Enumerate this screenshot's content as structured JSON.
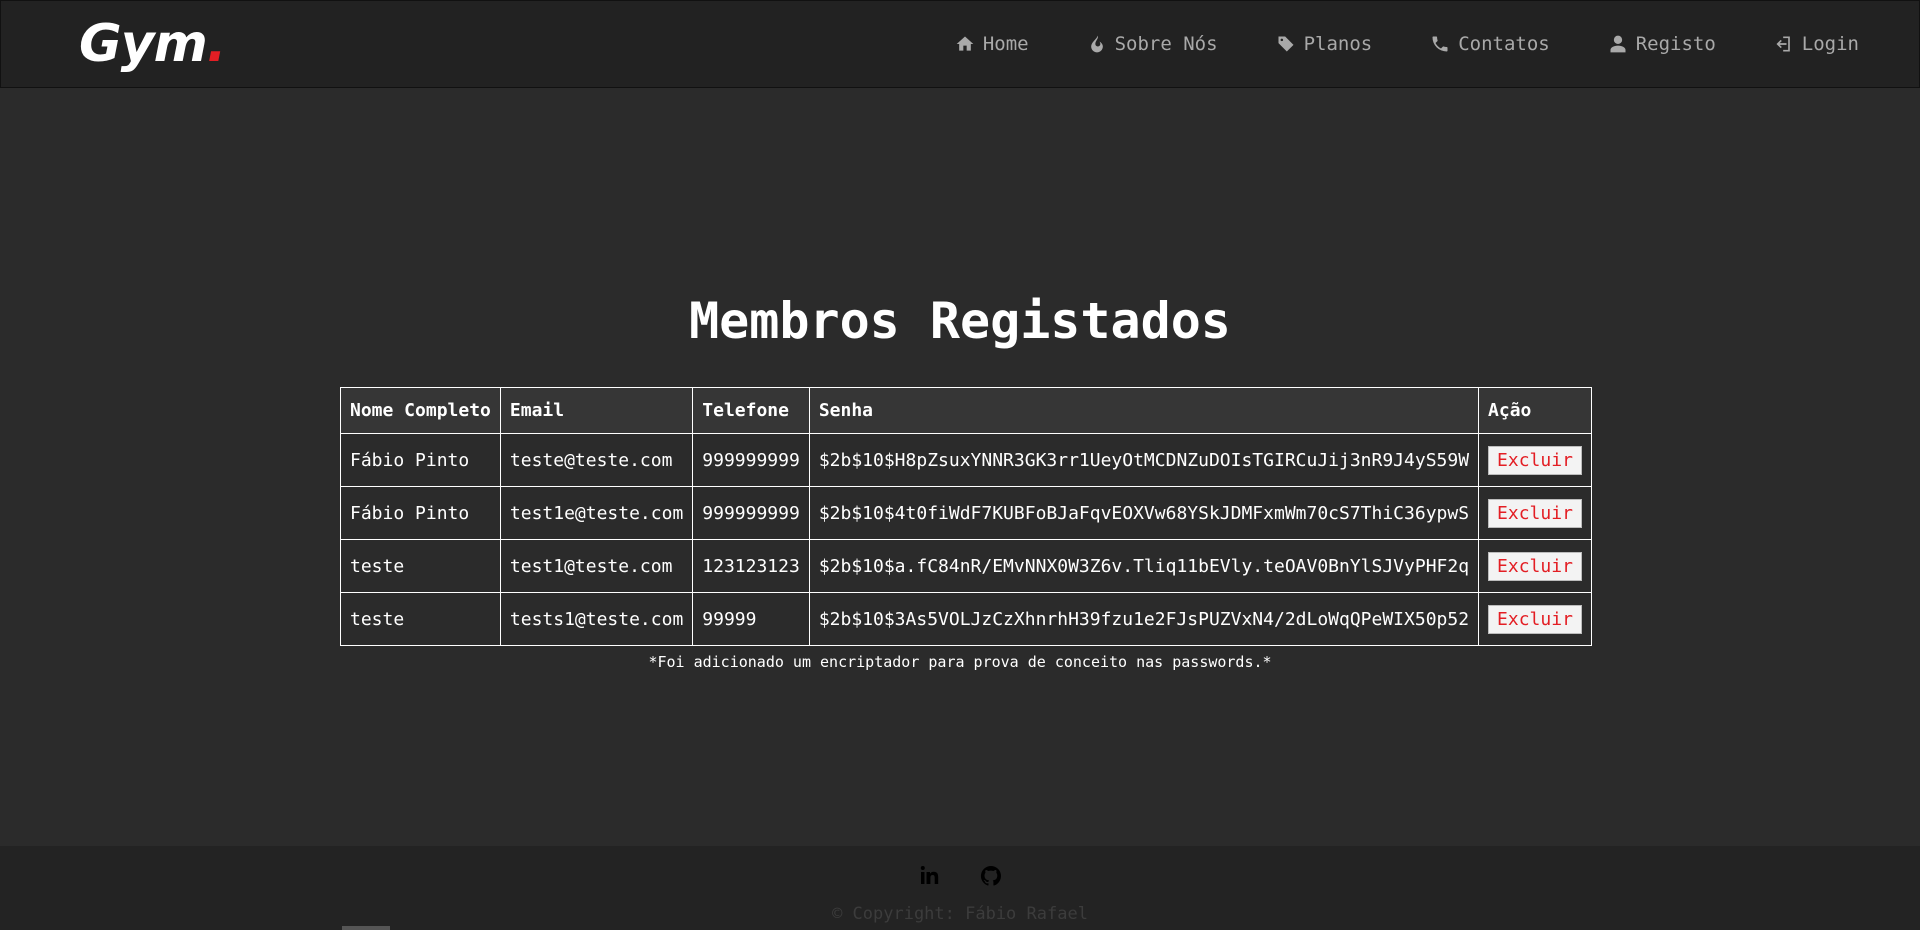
{
  "brand": {
    "name": "Gym",
    "dot": "."
  },
  "nav": {
    "items": [
      {
        "label": "Home",
        "icon": "home-icon"
      },
      {
        "label": "Sobre Nós",
        "icon": "fire-icon"
      },
      {
        "label": "Planos",
        "icon": "tag-icon"
      },
      {
        "label": "Contatos",
        "icon": "phone-icon"
      },
      {
        "label": "Registo",
        "icon": "user-icon"
      },
      {
        "label": "Login",
        "icon": "login-icon"
      }
    ]
  },
  "main": {
    "title": "Membros Registados",
    "table": {
      "headers": [
        "Nome Completo",
        "Email",
        "Telefone",
        "Senha",
        "Ação"
      ],
      "rows": [
        {
          "name": "Fábio Pinto",
          "email": "teste@teste.com",
          "phone": "999999999",
          "password": "$2b$10$H8pZsuxYNNR3GK3rr1UeyOtMCDNZuDOIsTGIRCuJij3nR9J4yS59W",
          "action": "Excluir"
        },
        {
          "name": "Fábio Pinto",
          "email": "test1e@teste.com",
          "phone": "999999999",
          "password": "$2b$10$4t0fiWdF7KUBFoBJaFqvEOXVw68YSkJDMFxmWm70cS7ThiC36ypwS",
          "action": "Excluir"
        },
        {
          "name": "teste",
          "email": "test1@teste.com",
          "phone": "123123123",
          "password": "$2b$10$a.fC84nR/EMvNNX0W3Z6v.Tliq11bEVly.teOAV0BnYlSJVyPHF2q",
          "action": "Excluir"
        },
        {
          "name": "teste",
          "email": "tests1@teste.com",
          "phone": "99999",
          "password": "$2b$10$3As5VOLJzCzXhnrhH39fzu1e2FJsPUZVxN4/2dLoWqQPeWIX50p52",
          "action": "Excluir"
        }
      ]
    },
    "note": "*Foi adicionado um encriptador para prova de conceito nas passwords.*"
  },
  "footer": {
    "social": [
      {
        "icon": "linkedin-icon"
      },
      {
        "icon": "github-icon"
      }
    ],
    "copyright": "© Copyright: Fábio Rafael"
  },
  "colors": {
    "accent": "#e31e24",
    "background": "#2b2b2b",
    "navbar": "#222222"
  }
}
